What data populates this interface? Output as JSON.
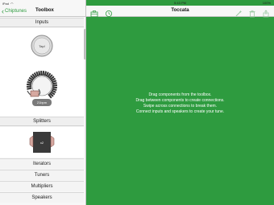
{
  "status": {
    "carrier": "iPad",
    "time": "5:43 PM",
    "battery": "100%"
  },
  "sidebar": {
    "back_label": "Chiptunes",
    "title": "Toolbox",
    "sections": {
      "inputs": "Inputs",
      "splitters": "Splitters",
      "iterators": "Iterators",
      "tuners": "Tuners",
      "multipliers": "Multipliers",
      "speakers": "Speakers"
    },
    "components": {
      "tap_label": "Tap!",
      "bpm_label": "21bpm",
      "splitter_count": "x2"
    }
  },
  "main": {
    "title": "Toccata",
    "instructions": [
      "Drag components from the toolbox.",
      "Drag between components to create connections.",
      "Swipe across connections to break them.",
      "Connect inputs and speakers to create your tune."
    ]
  },
  "colors": {
    "accent": "#2e9b3f",
    "canvas": "#2e9b3f"
  }
}
